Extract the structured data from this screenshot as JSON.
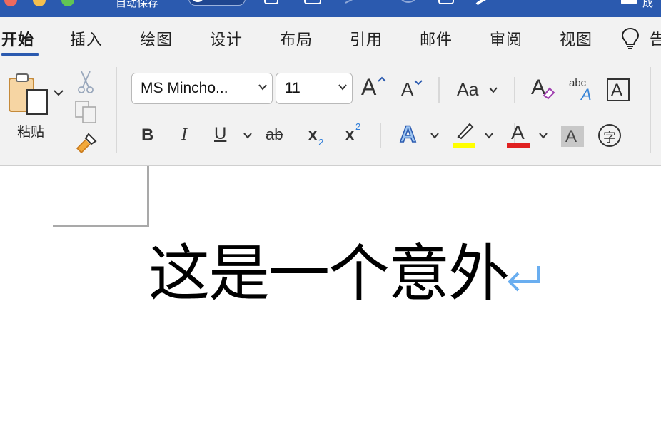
{
  "titlebar": {
    "autosave_label": "自动保存",
    "doc_title": "成"
  },
  "tabs": [
    {
      "label": "开始",
      "active": true
    },
    {
      "label": "插入"
    },
    {
      "label": "绘图"
    },
    {
      "label": "设计"
    },
    {
      "label": "布局"
    },
    {
      "label": "引用"
    },
    {
      "label": "邮件"
    },
    {
      "label": "审阅"
    },
    {
      "label": "视图"
    },
    {
      "label": "告"
    }
  ],
  "ribbon": {
    "paste_label": "粘贴",
    "font_name": "MS Mincho...",
    "font_size": "11",
    "grow_font": "A",
    "shrink_font": "A",
    "change_case": "Aa",
    "bold": "B",
    "italic": "I",
    "underline": "U",
    "strikethrough": "ab",
    "subscript_base": "x",
    "subscript_mark": "2",
    "superscript_base": "x",
    "superscript_mark": "2",
    "text_effects": "A",
    "font_color": "A",
    "char_shading": "A",
    "enclose_char": "字",
    "clear_format": "A",
    "phonetic_top": "abc",
    "phonetic_bottom": "A",
    "char_border": "A",
    "colors": {
      "accent": "#2b5aaf",
      "highlight": "#ffff00",
      "font_color_bar": "#e02020",
      "shading": "#c8c8c8"
    }
  },
  "document": {
    "text": "这是一个意外",
    "paragraph_mark": "pilcrow-return-icon"
  }
}
